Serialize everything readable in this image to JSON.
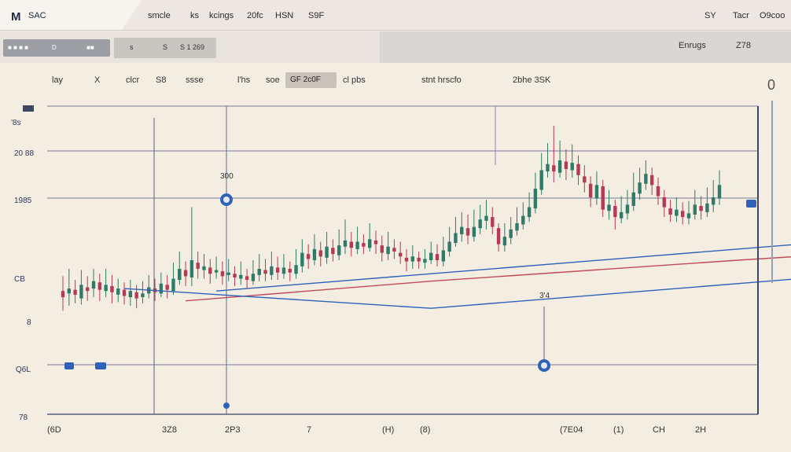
{
  "app": {
    "logo_mark": "M",
    "logo_name": "SAC"
  },
  "menu": [
    {
      "label": "smcle"
    },
    {
      "label": "ks"
    },
    {
      "label": "kcings"
    },
    {
      "label": "20fc"
    },
    {
      "label": "HSN"
    },
    {
      "label": "S9F"
    },
    {
      "label": "SY"
    },
    {
      "label": "Tacr"
    },
    {
      "label": "O9coo"
    }
  ],
  "toolbar": {
    "left_a": "■ ■ ■ ■",
    "left_b": "D",
    "left_c": "■■",
    "mid_a": "s",
    "mid_b": "S",
    "mid_c": "S 1 269",
    "right_a": "Enrugs",
    "right_b": "Z78"
  },
  "header_items": [
    {
      "label": "lay"
    },
    {
      "label": "X"
    },
    {
      "label": "clcr"
    },
    {
      "label": "S8"
    },
    {
      "label": "ssse"
    },
    {
      "label": "l'hs"
    },
    {
      "label": "soe"
    },
    {
      "label": "cl pbs"
    },
    {
      "label": "stnt hrscfo"
    },
    {
      "label": "2bhe 3SK"
    }
  ],
  "header_chip": "GF 2c0F",
  "y_axis_labels": [
    "'8s",
    "20 88",
    "1985",
    "CB",
    "8",
    "Q6L",
    "78"
  ],
  "x_axis_labels": [
    "(6D",
    "3Z8",
    "2P3",
    "7",
    "(H)",
    "(8)",
    "(7E04",
    "(1)",
    "CH",
    "2H"
  ],
  "annotations": {
    "a1": "300",
    "a2": "3'4",
    "corner": "0"
  },
  "colors": {
    "background": "#f4ede2",
    "grid": "#54607e",
    "up": "#2f7a68",
    "down": "#b43a55",
    "trend": "#2f63b8",
    "arrow": "#c24b5b"
  },
  "chart_data": {
    "type": "candlestick",
    "series": [
      {
        "values": [
          [
            400,
            395,
            412,
            384
          ],
          [
            398,
            402,
            418,
            388
          ],
          [
            401,
            397,
            409,
            390
          ],
          [
            394,
            405,
            417,
            389
          ],
          [
            403,
            400,
            412,
            392
          ],
          [
            402,
            408,
            418,
            395
          ],
          [
            407,
            401,
            414,
            392
          ],
          [
            400,
            405,
            418,
            395
          ],
          [
            404,
            399,
            413,
            390
          ],
          [
            397,
            402,
            410,
            391
          ],
          [
            401,
            396,
            407,
            389
          ],
          [
            395,
            400,
            409,
            388
          ],
          [
            399,
            394,
            405,
            386
          ],
          [
            395,
            398,
            408,
            390
          ],
          [
            398,
            403,
            413,
            394
          ],
          [
            402,
            399,
            410,
            392
          ],
          [
            398,
            406,
            415,
            395
          ],
          [
            405,
            401,
            413,
            394
          ],
          [
            400,
            410,
            423,
            397
          ],
          [
            409,
            418,
            432,
            405
          ],
          [
            417,
            412,
            424,
            404
          ],
          [
            411,
            425,
            468,
            404
          ],
          [
            423,
            418,
            432,
            410
          ],
          [
            417,
            420,
            430,
            410
          ],
          [
            419,
            414,
            426,
            406
          ],
          [
            415,
            417,
            428,
            410
          ],
          [
            416,
            412,
            424,
            405
          ],
          [
            413,
            415,
            426,
            408
          ],
          [
            414,
            411,
            420,
            404
          ],
          [
            410,
            413,
            424,
            405
          ],
          [
            412,
            409,
            418,
            402
          ],
          [
            408,
            414,
            425,
            405
          ],
          [
            413,
            418,
            430,
            408
          ],
          [
            417,
            414,
            426,
            408
          ],
          [
            413,
            420,
            432,
            409
          ],
          [
            419,
            415,
            428,
            409
          ],
          [
            414,
            419,
            430,
            410
          ],
          [
            418,
            415,
            424,
            408
          ],
          [
            414,
            421,
            434,
            410
          ],
          [
            420,
            431,
            442,
            415
          ],
          [
            430,
            426,
            438,
            418
          ],
          [
            425,
            434,
            446,
            421
          ],
          [
            433,
            428,
            440,
            420
          ],
          [
            427,
            436,
            448,
            422
          ],
          [
            435,
            430,
            442,
            424
          ],
          [
            429,
            437,
            450,
            425
          ],
          [
            436,
            441,
            458,
            430
          ],
          [
            440,
            435,
            448,
            428
          ],
          [
            434,
            440,
            452,
            430
          ],
          [
            439,
            436,
            446,
            430
          ],
          [
            435,
            442,
            455,
            432
          ],
          [
            441,
            438,
            449,
            430
          ],
          [
            437,
            431,
            445,
            424
          ],
          [
            430,
            436,
            448,
            425
          ],
          [
            435,
            432,
            442,
            426
          ],
          [
            431,
            428,
            440,
            422
          ],
          [
            427,
            424,
            434,
            416
          ],
          [
            424,
            428,
            437,
            418
          ],
          [
            427,
            424,
            432,
            418
          ],
          [
            423,
            426,
            434,
            418
          ],
          [
            425,
            431,
            440,
            422
          ],
          [
            430,
            425,
            438,
            420
          ],
          [
            424,
            433,
            444,
            420
          ],
          [
            432,
            440,
            452,
            428
          ],
          [
            439,
            447,
            460,
            436
          ],
          [
            446,
            452,
            464,
            440
          ],
          [
            451,
            445,
            462,
            438
          ],
          [
            444,
            452,
            466,
            440
          ],
          [
            451,
            458,
            470,
            446
          ],
          [
            457,
            461,
            474,
            450
          ],
          [
            460,
            452,
            468,
            446
          ],
          [
            451,
            438,
            455,
            432
          ],
          [
            437,
            444,
            455,
            432
          ],
          [
            443,
            450,
            460,
            438
          ],
          [
            449,
            455,
            468,
            445
          ],
          [
            454,
            461,
            472,
            450
          ],
          [
            460,
            468,
            480,
            456
          ],
          [
            467,
            483,
            496,
            463
          ],
          [
            482,
            498,
            512,
            478
          ],
          [
            497,
            503,
            520,
            492
          ],
          [
            502,
            497,
            534,
            488
          ],
          [
            496,
            506,
            522,
            492
          ],
          [
            505,
            499,
            515,
            490
          ],
          [
            498,
            504,
            519,
            492
          ],
          [
            503,
            494,
            510,
            486
          ],
          [
            493,
            488,
            502,
            480
          ],
          [
            487,
            476,
            493,
            468
          ],
          [
            475,
            486,
            497,
            470
          ],
          [
            485,
            466,
            490,
            460
          ],
          [
            465,
            470,
            482,
            458
          ],
          [
            469,
            460,
            474,
            450
          ],
          [
            459,
            464,
            477,
            455
          ],
          [
            463,
            470,
            482,
            458
          ],
          [
            469,
            480,
            496,
            465
          ],
          [
            479,
            488,
            500,
            474
          ],
          [
            487,
            495,
            506,
            482
          ],
          [
            494,
            486,
            500,
            478
          ],
          [
            485,
            477,
            492,
            470
          ],
          [
            476,
            468,
            482,
            460
          ],
          [
            467,
            462,
            474,
            456
          ],
          [
            461,
            466,
            476,
            456
          ],
          [
            465,
            460,
            472,
            454
          ],
          [
            459,
            463,
            473,
            454
          ],
          [
            462,
            470,
            482,
            458
          ],
          [
            469,
            465,
            477,
            458
          ],
          [
            464,
            471,
            484,
            460
          ],
          [
            470,
            476,
            490,
            464
          ],
          [
            475,
            486,
            498,
            470
          ]
        ]
      }
    ],
    "trendlines": [
      {
        "points": [
          [
            25,
            400
          ],
          [
            90,
            426
          ],
          [
            140,
            446
          ],
          [
            190,
            470
          ]
        ]
      },
      {
        "points": [
          [
            20,
            392
          ],
          [
            60,
            408
          ],
          [
            110,
            425
          ],
          [
            158,
            440
          ]
        ]
      },
      {
        "points": [
          [
            10,
            402
          ],
          [
            60,
            386
          ],
          [
            120,
            410
          ]
        ]
      },
      {
        "points": [
          [
            160,
            401
          ],
          [
            230,
            430
          ]
        ]
      }
    ]
  }
}
